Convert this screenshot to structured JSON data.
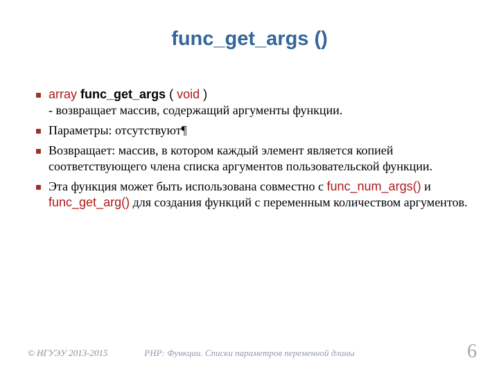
{
  "title": "func_get_args ()",
  "signature": {
    "return_type": "array",
    "func_name": "func_get_args",
    "open": " ( ",
    "param": "void",
    "close": " )"
  },
  "bullets": {
    "b1_rest": "- возвращает массив, содержащий аргументы функции.",
    "b2": "Параметры: отсутствуют¶",
    "b3": "Возвращает: массив, в котором каждый элемент является копией соответствующего члена списка аргументов пользовательской функции.",
    "b4_pre": "Эта функция может быть использована совместно с ",
    "b4_fn1": "func_num_args()",
    "b4_mid": " и ",
    "b4_fn2": "func_get_arg()",
    "b4_post": " для создания функций с переменным количеством аргументов."
  },
  "footer": {
    "copyright": "© НГУЭУ 2013-2015",
    "course": "PHP: Функции. Списки параметров переменной длины",
    "page": "6"
  }
}
